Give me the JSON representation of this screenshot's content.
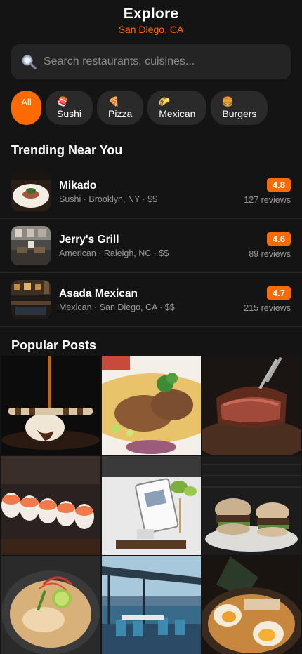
{
  "header": {
    "title": "Explore",
    "location": "San Diego, CA"
  },
  "search": {
    "placeholder": "Search restaurants, cuisines..."
  },
  "categories": [
    {
      "label": "All",
      "emoji": "",
      "active": true
    },
    {
      "label": "Sushi",
      "emoji": "🍣",
      "active": false
    },
    {
      "label": "Pizza",
      "emoji": "🍕",
      "active": false
    },
    {
      "label": "Mexican",
      "emoji": "🌮",
      "active": false
    },
    {
      "label": "Burgers",
      "emoji": "🍔",
      "active": false
    }
  ],
  "trending": {
    "title": "Trending Near You",
    "items": [
      {
        "name": "Mikado",
        "meta": "Sushi · Brooklyn, NY · $$",
        "rating": "4.8",
        "reviews": "127 reviews"
      },
      {
        "name": "Jerry's Grill",
        "meta": "American · Raleigh, NC · $$",
        "rating": "4.6",
        "reviews": "89 reviews"
      },
      {
        "name": "Asada Mexican",
        "meta": "Mexican · San Diego, CA · $$",
        "rating": "4.7",
        "reviews": "215 reviews"
      }
    ]
  },
  "posts": {
    "title": "Popular Posts",
    "items": [
      "dessert-photo",
      "tacos-photo",
      "steak-photo",
      "sushi-photo",
      "menu-tablet-photo",
      "burgers-photo",
      "ramen-photo",
      "patio-photo",
      "egg-ramen-photo"
    ]
  },
  "colors": {
    "accent": "#ff6a00",
    "background": "#141414",
    "surface": "#242424",
    "chip": "#2a2a2a"
  }
}
